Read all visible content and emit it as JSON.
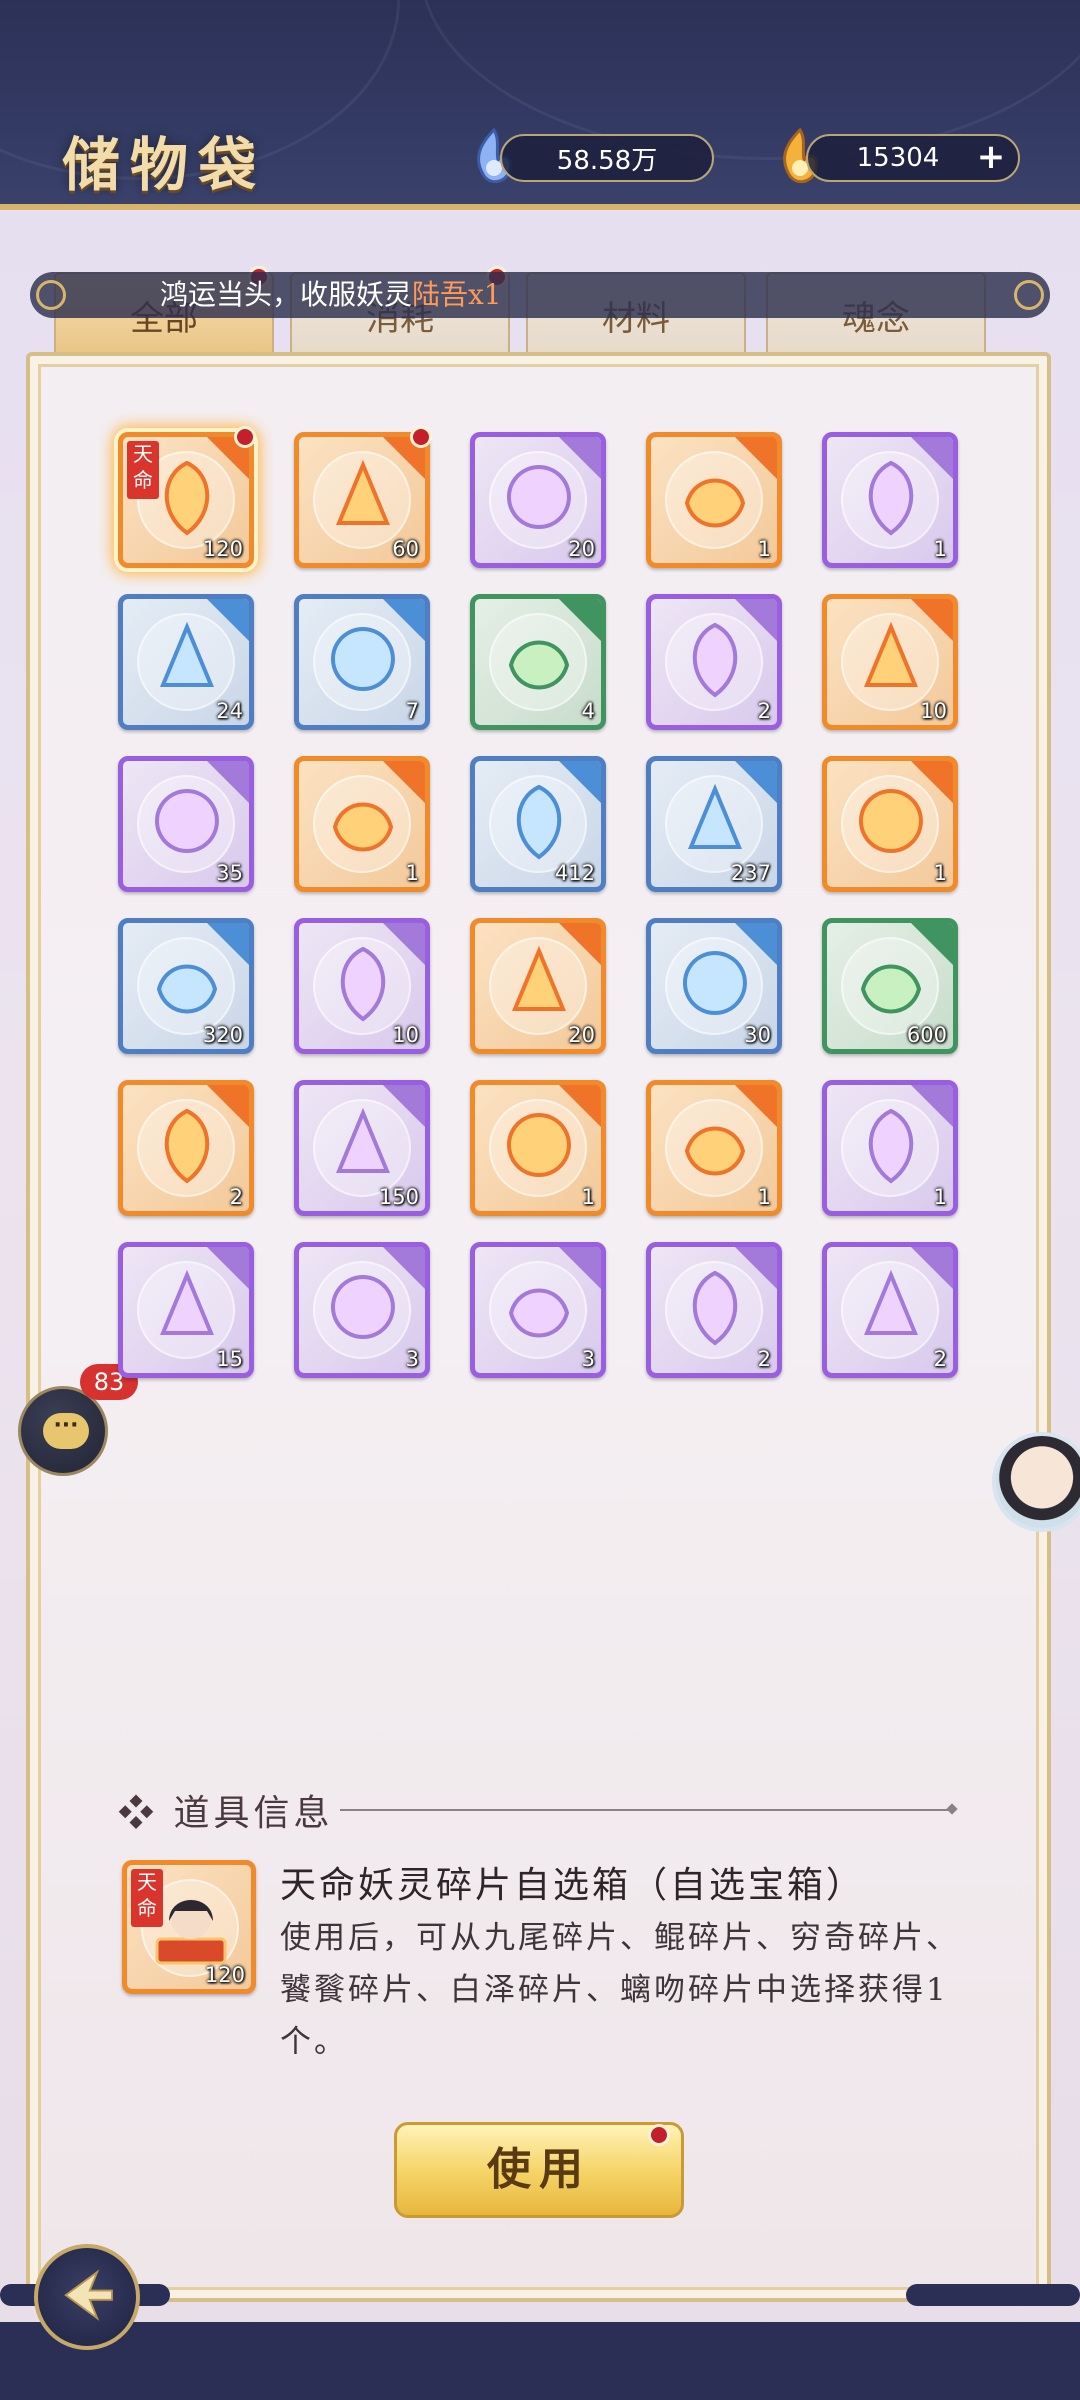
{
  "header": {
    "title": "储物袋",
    "currency_1": "58.58万",
    "currency_2": "15304",
    "add_label": "+"
  },
  "ticker": {
    "prefix": "鸿运当头，收服妖灵",
    "highlight": "陆吾x1"
  },
  "tabs": [
    "全部",
    "消耗",
    "材料",
    "魂念"
  ],
  "items": [
    {
      "count": "120",
      "rarity": "orange",
      "tag": "天命",
      "dot": true,
      "selected": true
    },
    {
      "count": "60",
      "rarity": "orange",
      "dot": true
    },
    {
      "count": "20",
      "rarity": "purple"
    },
    {
      "count": "1",
      "rarity": "orange"
    },
    {
      "count": "1",
      "rarity": "purple"
    },
    {
      "count": "24",
      "rarity": "blue"
    },
    {
      "count": "7",
      "rarity": "blue"
    },
    {
      "count": "4",
      "rarity": "green"
    },
    {
      "count": "2",
      "rarity": "purple"
    },
    {
      "count": "10",
      "rarity": "orange"
    },
    {
      "count": "35",
      "rarity": "purple"
    },
    {
      "count": "1",
      "rarity": "orange"
    },
    {
      "count": "412",
      "rarity": "blue"
    },
    {
      "count": "237",
      "rarity": "blue"
    },
    {
      "count": "1",
      "rarity": "orange"
    },
    {
      "count": "320",
      "rarity": "blue"
    },
    {
      "count": "10",
      "rarity": "purple"
    },
    {
      "count": "20",
      "rarity": "orange"
    },
    {
      "count": "30",
      "rarity": "blue"
    },
    {
      "count": "600",
      "rarity": "green"
    },
    {
      "count": "2",
      "rarity": "orange"
    },
    {
      "count": "150",
      "rarity": "purple"
    },
    {
      "count": "1",
      "rarity": "orange"
    },
    {
      "count": "1",
      "rarity": "orange"
    },
    {
      "count": "1",
      "rarity": "purple"
    },
    {
      "count": "15",
      "rarity": "purple"
    },
    {
      "count": "3",
      "rarity": "purple"
    },
    {
      "count": "3",
      "rarity": "purple"
    },
    {
      "count": "2",
      "rarity": "purple"
    },
    {
      "count": "2",
      "rarity": "purple"
    }
  ],
  "chat": {
    "badge": "83",
    "icon_label": "···"
  },
  "info": {
    "heading": "❖ 道具信息",
    "item_name": "天命妖灵碎片自选箱（自选宝箱）",
    "description": "使用后，可从九尾碎片、鲲碎片、穷奇碎片、饕餮碎片、白泽碎片、螭吻碎片中选择获得1个。",
    "icon_count": "120",
    "icon_tag": "天命"
  },
  "use_button": "使用"
}
